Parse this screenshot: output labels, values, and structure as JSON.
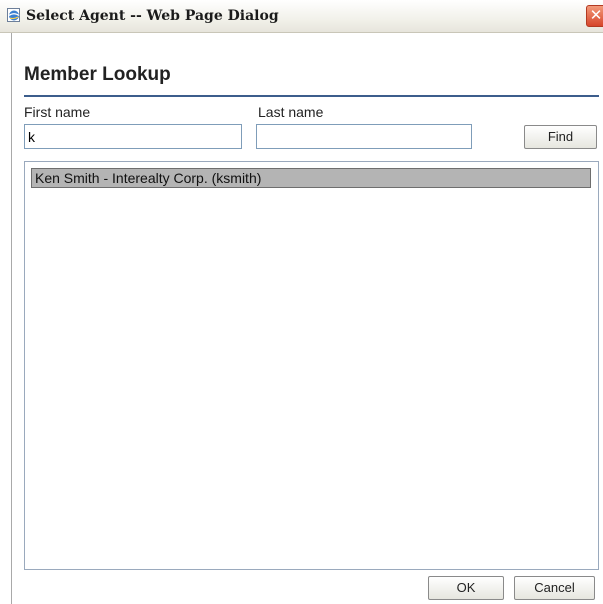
{
  "window": {
    "title": "Select Agent -- Web Page Dialog",
    "icon": "ie-page-icon",
    "close_glyph": "✕"
  },
  "heading": "Member Lookup",
  "form": {
    "first_name_label": "First name",
    "first_name_value": "k",
    "last_name_label": "Last name",
    "last_name_value": "",
    "find_label": "Find"
  },
  "results": [
    {
      "label": "Ken Smith - Interealty Corp. (ksmith)",
      "selected": true
    }
  ],
  "footer": {
    "ok_label": "OK",
    "cancel_label": "Cancel"
  },
  "colors": {
    "heading_rule": "#3c5d8c",
    "selected_row": "#b4b4b4",
    "close_button": "#d6452b"
  }
}
